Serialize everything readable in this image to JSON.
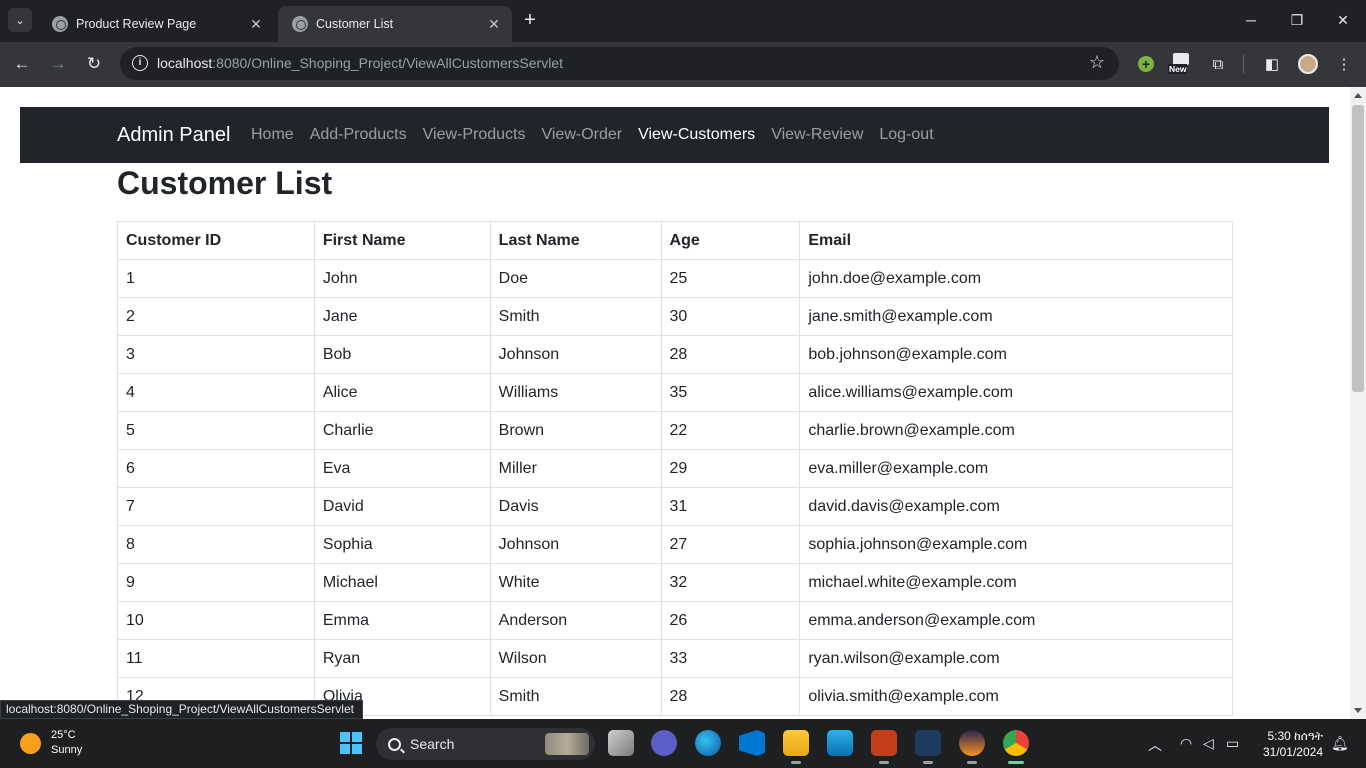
{
  "browser": {
    "tabs": [
      {
        "title": "Product Review Page",
        "active": false
      },
      {
        "title": "Customer List",
        "active": true
      }
    ],
    "new_tab_label": "+",
    "url_host": "localhost",
    "url_rest": ":8080/Online_Shoping_Project/ViewAllCustomersServlet",
    "extension_new_label": "New",
    "status_url": "localhost:8080/Online_Shoping_Project/ViewAllCustomersServlet"
  },
  "navbar": {
    "brand": "Admin Panel",
    "links": [
      {
        "label": "Home",
        "active": false
      },
      {
        "label": "Add-Products",
        "active": false
      },
      {
        "label": "View-Products",
        "active": false
      },
      {
        "label": "View-Order",
        "active": false
      },
      {
        "label": "View-Customers",
        "active": true
      },
      {
        "label": "View-Review",
        "active": false
      },
      {
        "label": "Log-out",
        "active": false
      }
    ]
  },
  "page": {
    "title": "Customer List",
    "columns": [
      "Customer ID",
      "First Name",
      "Last Name",
      "Age",
      "Email"
    ],
    "rows": [
      [
        "1",
        "John",
        "Doe",
        "25",
        "john.doe@example.com"
      ],
      [
        "2",
        "Jane",
        "Smith",
        "30",
        "jane.smith@example.com"
      ],
      [
        "3",
        "Bob",
        "Johnson",
        "28",
        "bob.johnson@example.com"
      ],
      [
        "4",
        "Alice",
        "Williams",
        "35",
        "alice.williams@example.com"
      ],
      [
        "5",
        "Charlie",
        "Brown",
        "22",
        "charlie.brown@example.com"
      ],
      [
        "6",
        "Eva",
        "Miller",
        "29",
        "eva.miller@example.com"
      ],
      [
        "7",
        "David",
        "Davis",
        "31",
        "david.davis@example.com"
      ],
      [
        "8",
        "Sophia",
        "Johnson",
        "27",
        "sophia.johnson@example.com"
      ],
      [
        "9",
        "Michael",
        "White",
        "32",
        "michael.white@example.com"
      ],
      [
        "10",
        "Emma",
        "Anderson",
        "26",
        "emma.anderson@example.com"
      ],
      [
        "11",
        "Ryan",
        "Wilson",
        "33",
        "ryan.wilson@example.com"
      ],
      [
        "12",
        "Olivia",
        "Smith",
        "28",
        "olivia.smith@example.com"
      ]
    ]
  },
  "taskbar": {
    "weather_temp": "25°C",
    "weather_desc": "Sunny",
    "search_label": "Search",
    "clock_time": "5:30 ከሰዓት",
    "clock_date": "31/01/2024"
  },
  "colors": {
    "navbar_bg": "#212529",
    "chrome_bg": "#202124",
    "toolbar_bg": "#35363a",
    "table_border": "#dee2e6"
  }
}
